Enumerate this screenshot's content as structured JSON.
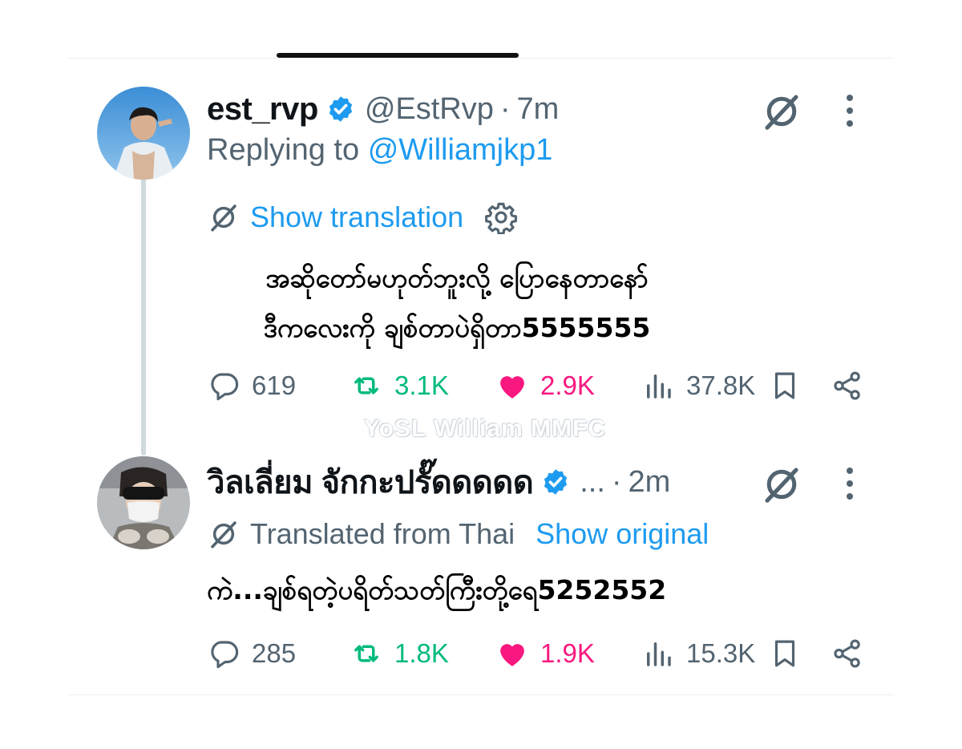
{
  "tweets": [
    {
      "display_name": "est_rvp",
      "handle": "@EstRvp",
      "separator": "·",
      "time": "7m",
      "replying_prefix": "Replying to",
      "replying_to": "@Williamjkp1",
      "translate_link": "Show translation",
      "body_lines": [
        "အဆိုတော်မဟုတ်ဘူးလို့ ပြောနေတာနော်",
        "ဒီကလေးကို ချစ်တာပဲရှိတာ5555555"
      ],
      "counts": {
        "replies": "619",
        "reposts": "3.1K",
        "likes": "2.9K",
        "views": "37.8K"
      }
    },
    {
      "display_name": "วิลเลี่ยม จักกะปรั๊ดดดดด",
      "handle": "...",
      "separator": "·",
      "time": "2m",
      "translated_from": "Translated from Thai",
      "translate_link": "Show original",
      "body_lines": [
        "ကဲ...ချစ်ရတဲ့ပရိတ်သတ်ကြီးတို့ရေ5252552"
      ],
      "counts": {
        "replies": "285",
        "reposts": "1.8K",
        "likes": "1.9K",
        "views": "15.3K"
      }
    }
  ],
  "watermark": "YoSL William MMFC",
  "icons": {
    "verified": "verified-badge-icon",
    "grok": "grok-icon",
    "more": "more-vertical-icon",
    "reply": "reply-icon",
    "repost": "repost-icon",
    "like": "heart-icon",
    "views": "views-icon",
    "bookmark": "bookmark-icon",
    "share": "share-icon",
    "settings": "gear-icon"
  },
  "colors": {
    "link": "#1d9bf0",
    "muted": "#536471",
    "repost": "#00ba7c",
    "like": "#f91880",
    "text": "#0f1419"
  }
}
